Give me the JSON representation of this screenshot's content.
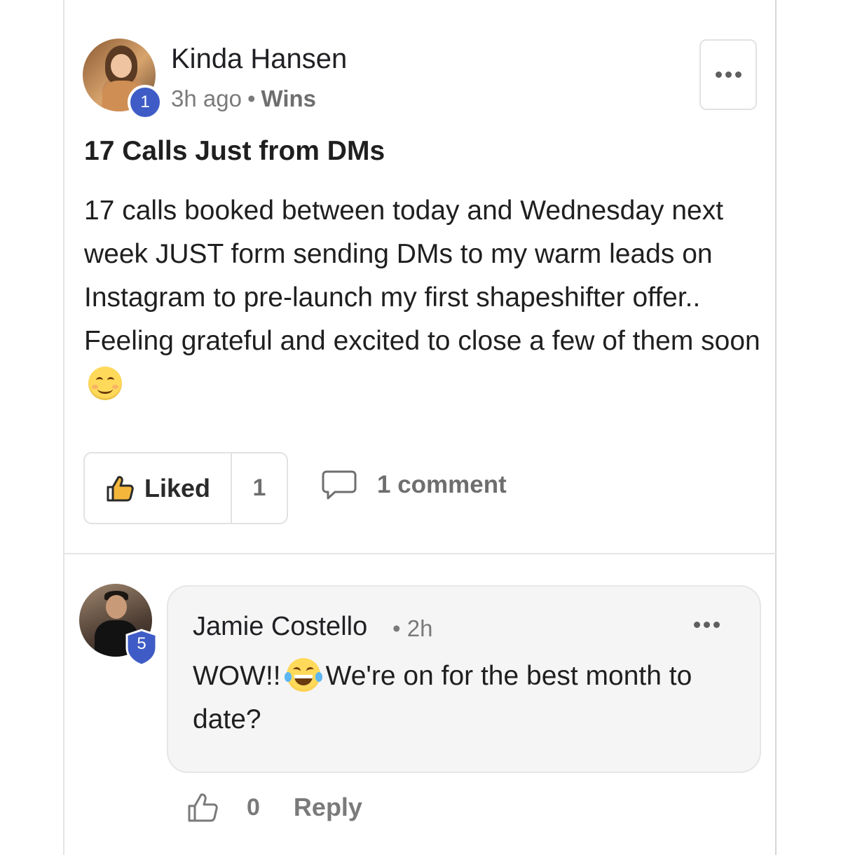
{
  "post": {
    "author": {
      "name": "Kinda Hansen",
      "level": "1"
    },
    "time": "3h ago",
    "separator": "•",
    "category": "Wins",
    "title": "17 Calls Just from DMs",
    "body": "17 calls booked between today and Wednesday next week JUST form sending DMs to my warm leads on Instagram to pre-launch my first shapeshifter offer.. Feeling grateful and excited to close a few of them soon",
    "body_emoji": "smiling-face-emoji",
    "like": {
      "label": "Liked",
      "count": "1",
      "icon": "thumbs-up-icon"
    },
    "comments": {
      "label": "1 comment",
      "icon": "speech-bubble-icon"
    },
    "more_icon": "ellipsis-icon"
  },
  "comment": {
    "author": {
      "name": "Jamie Costello",
      "level": "5"
    },
    "separator": "•",
    "time": "2h",
    "text_before": "WOW!!",
    "text_emoji": "tears-of-joy-emoji",
    "text_after": "We're on for the best month to date?",
    "like_count": "0",
    "reply_label": "Reply"
  },
  "colors": {
    "badge_blue": "#3f5cc6",
    "bubble_bg": "#f5f5f5",
    "muted_text": "#7a7a7a"
  }
}
